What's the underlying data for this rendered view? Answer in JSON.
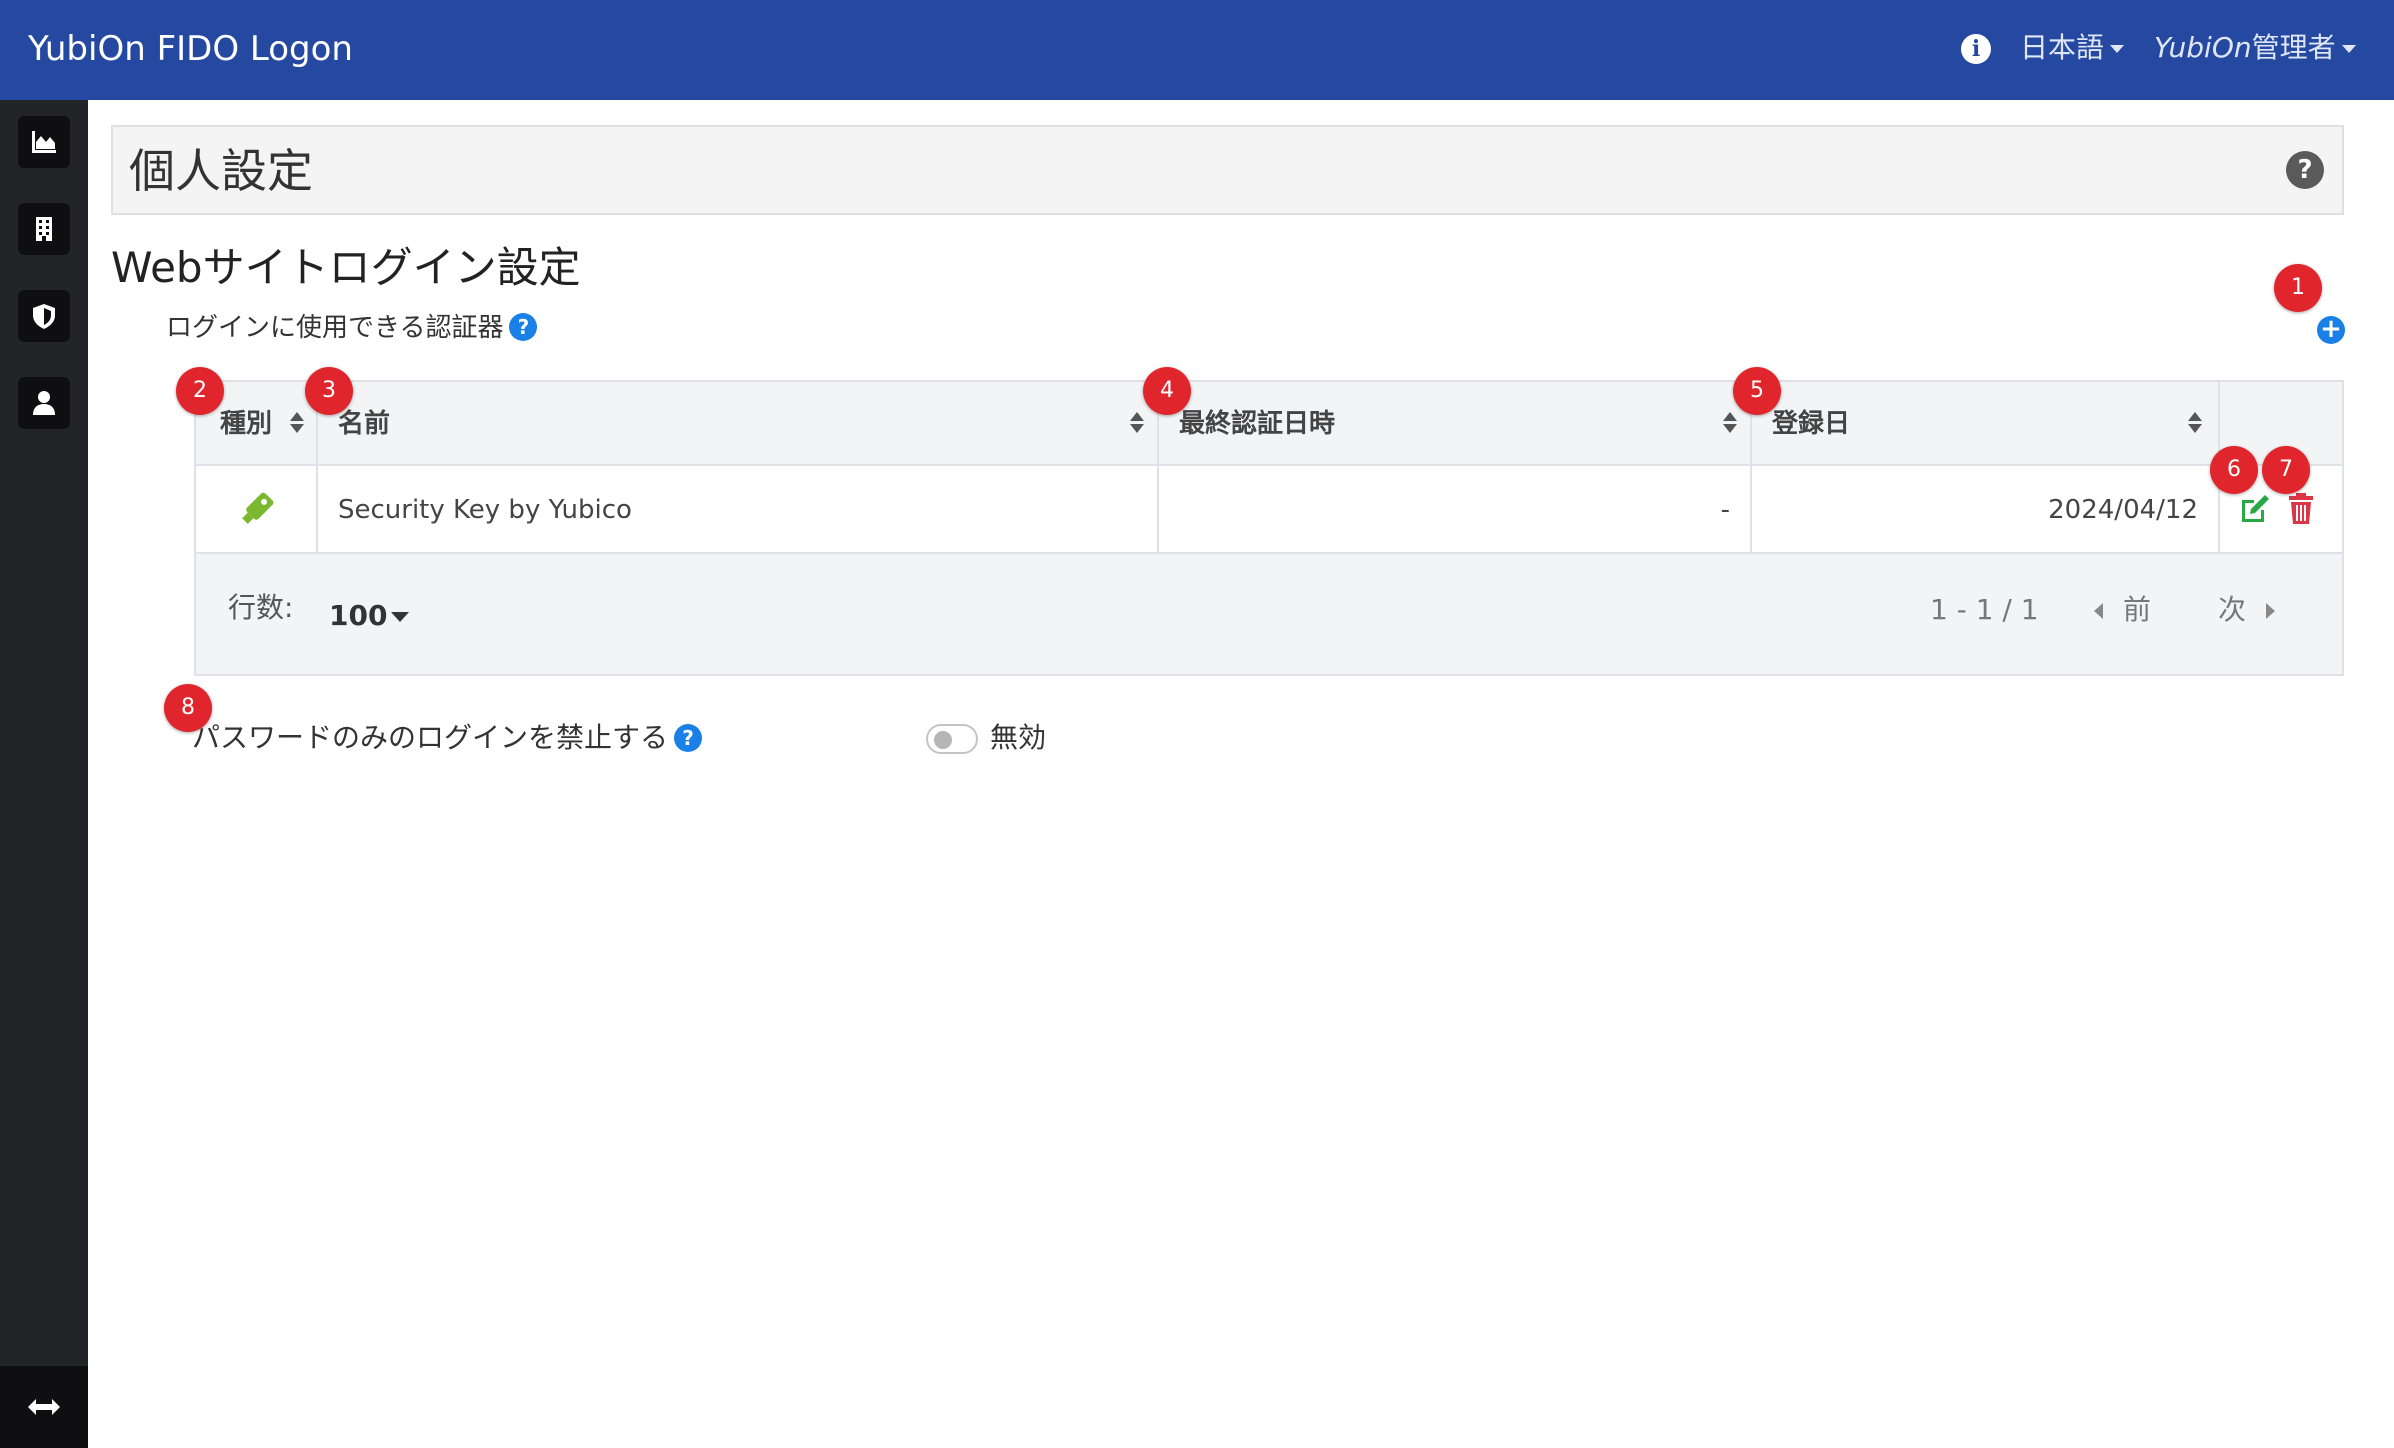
{
  "topbar": {
    "brand": "YubiOn FIDO Logon",
    "info_icon": "info-icon",
    "language": "日本語",
    "user_italic": "YubiOn",
    "user_suffix": "管理者"
  },
  "sidebar": {
    "items": [
      {
        "icon": "chart-area-icon"
      },
      {
        "icon": "building-icon"
      },
      {
        "icon": "shield-icon"
      },
      {
        "icon": "user-icon"
      }
    ],
    "bottom_icon": "arrows-horizontal-icon"
  },
  "page": {
    "title": "個人設定",
    "help": "?"
  },
  "section": {
    "title": "Webサイトログイン設定",
    "subhead": "ログインに使用できる認証器",
    "help": "?",
    "add": "+"
  },
  "table": {
    "columns": [
      "種別",
      "名前",
      "最終認証日時",
      "登録日"
    ],
    "rows": [
      {
        "type_icon": "usb-key-icon",
        "name": "Security Key by Yubico",
        "last_auth": "-",
        "registered": "2024/04/12"
      }
    ],
    "footer": {
      "rows_label": "行数:",
      "rows_value": "100",
      "range": "1 - 1 / 1",
      "prev": "前",
      "next": "次"
    }
  },
  "password_only": {
    "label": "パスワードのみのログインを禁止する",
    "help": "?",
    "state": "無効",
    "enabled": false
  },
  "markers": [
    "1",
    "2",
    "3",
    "4",
    "5",
    "6",
    "7",
    "8"
  ],
  "colors": {
    "navbar": "#2548a0",
    "sidebar": "#232427",
    "accent_blue": "#1a7fe6",
    "marker_red": "#e0262c",
    "edit_green": "#28a745",
    "delete_red": "#dc3545",
    "key_green": "#7cb82f"
  }
}
